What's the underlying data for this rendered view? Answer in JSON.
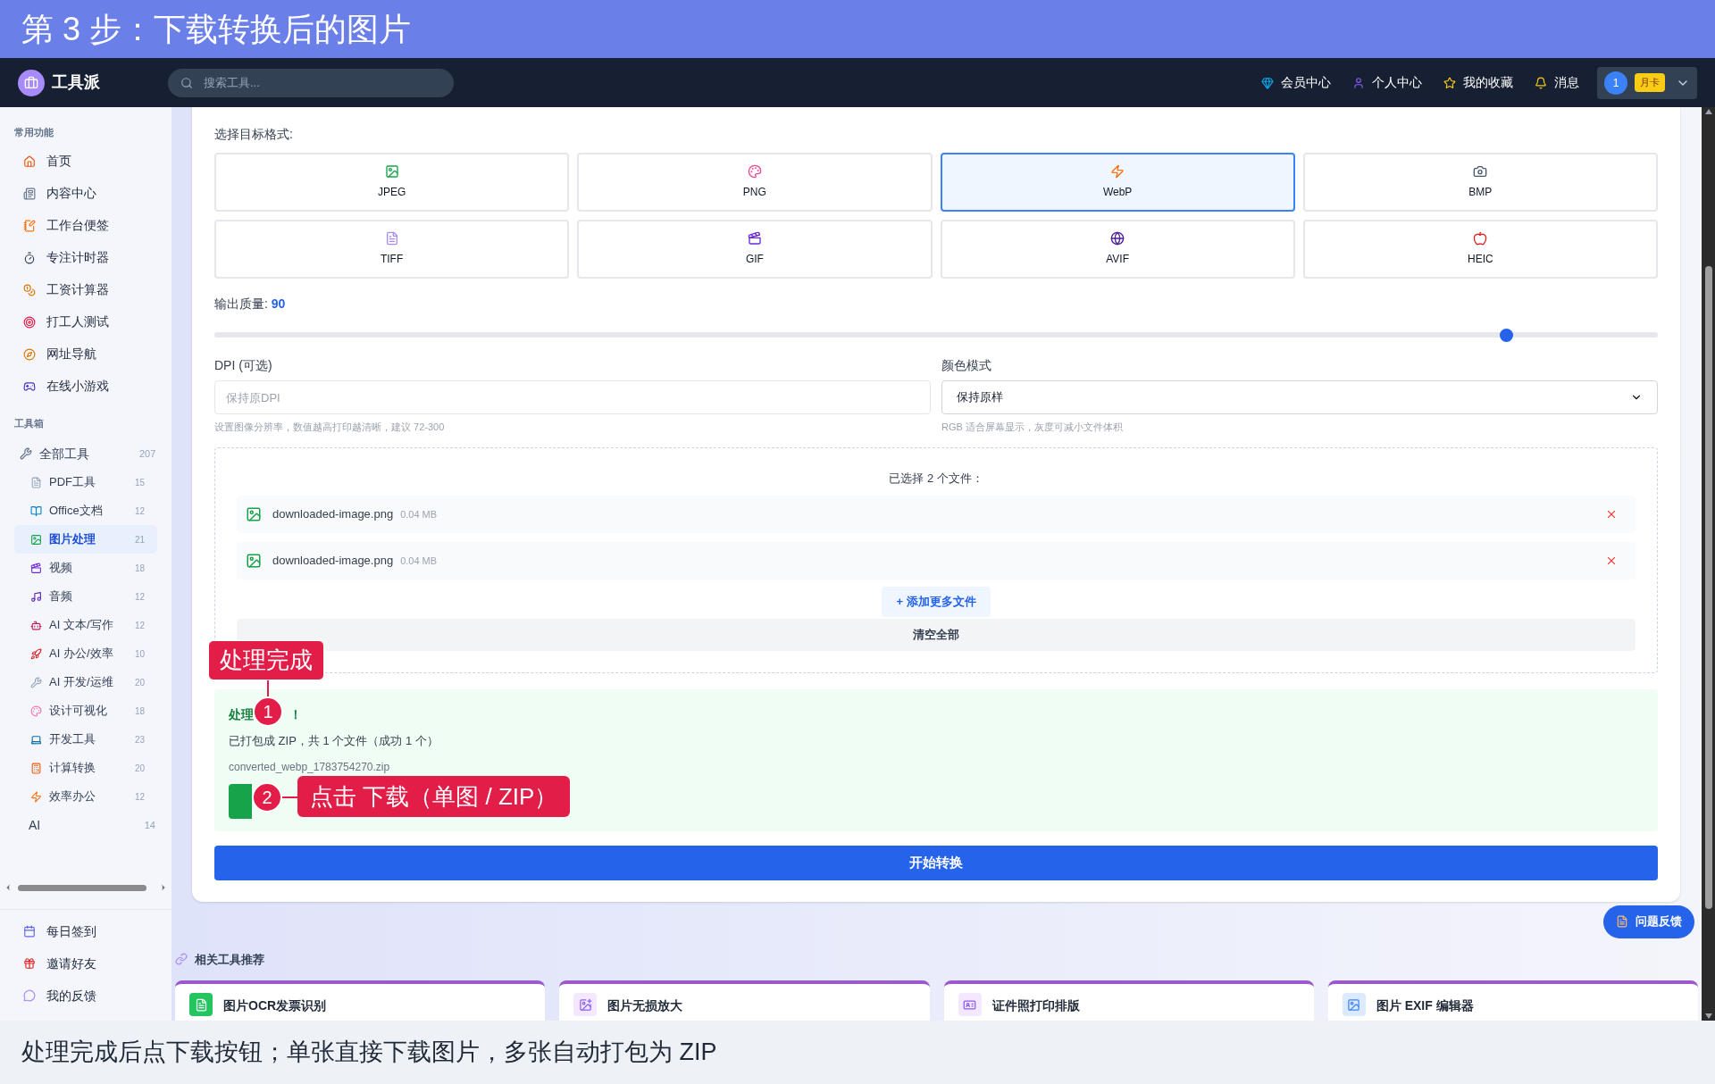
{
  "banner": {
    "title": "第 3 步：下载转换后的图片"
  },
  "header": {
    "logo": "工具派",
    "search_placeholder": "搜索工具...",
    "nav": [
      "会员中心",
      "个人中心",
      "我的收藏",
      "消息"
    ],
    "avatar": "1",
    "badge": "月卡"
  },
  "sidebar": {
    "sections": [
      {
        "title": "常用功能",
        "items": [
          {
            "label": "首页"
          },
          {
            "label": "内容中心"
          },
          {
            "label": "工作台便签"
          },
          {
            "label": "专注计时器"
          },
          {
            "label": "工资计算器"
          },
          {
            "label": "打工人测试"
          },
          {
            "label": "网址导航"
          },
          {
            "label": "在线小游戏"
          }
        ]
      },
      {
        "title": "工具箱",
        "items": [
          {
            "label": "全部工具",
            "count": "207",
            "selected": false,
            "children": [
              {
                "label": "PDF工具",
                "count": "15",
                "selected": false
              },
              {
                "label": "Office文档",
                "count": "12",
                "selected": false
              },
              {
                "label": "图片处理",
                "count": "21",
                "selected": true
              },
              {
                "label": "视频",
                "count": "18",
                "selected": false
              },
              {
                "label": "音频",
                "count": "12",
                "selected": false
              },
              {
                "label": "AI 文本/写作",
                "count": "12",
                "selected": false
              },
              {
                "label": "AI 办公/效率",
                "count": "10",
                "selected": false
              },
              {
                "label": "AI 开发/运维",
                "count": "20",
                "selected": false
              },
              {
                "label": "设计可视化",
                "count": "18",
                "selected": false
              },
              {
                "label": "开发工具",
                "count": "23",
                "selected": false
              },
              {
                "label": "计算转换",
                "count": "20",
                "selected": false
              },
              {
                "label": "效率办公",
                "count": "12",
                "selected": false
              }
            ]
          },
          {
            "label": "AI",
            "count": "14",
            "selected": false
          }
        ]
      }
    ],
    "bottom_items": [
      "每日签到",
      "邀请好友",
      "我的反馈"
    ]
  },
  "format_label": "选择目标格式:",
  "formats": [
    {
      "label": "JPEG",
      "selected": false
    },
    {
      "label": "PNG",
      "selected": false
    },
    {
      "label": "WebP",
      "selected": true
    },
    {
      "label": "BMP",
      "selected": false
    },
    {
      "label": "TIFF",
      "selected": false
    },
    {
      "label": "GIF",
      "selected": false
    },
    {
      "label": "AVIF",
      "selected": false
    },
    {
      "label": "HEIC",
      "selected": false
    }
  ],
  "quality": {
    "label": "输出质量:",
    "value": "90",
    "level": 0.895
  },
  "dpi": {
    "label": "DPI (可选)",
    "placeholder": "保持原DPI",
    "hint": "设置图像分辨率，数值越高打印越清晰，建议 72-300"
  },
  "color_mode": {
    "label": "颜色模式",
    "value": "保持原样",
    "hint": "RGB 适合屏幕显示，灰度可减小文件体积"
  },
  "files": {
    "title": "已选择 2 个文件：",
    "items": [
      {
        "name": "downloaded-image.png",
        "size": "0.04 MB"
      },
      {
        "name": "downloaded-image.png",
        "size": "0.04 MB"
      }
    ],
    "add": "+ 添加更多文件",
    "clear": "清空全部"
  },
  "result": {
    "heading_parts": [
      "处理",
      "！"
    ],
    "summary": "已打包成 ZIP，共 1 个文件（成功 1 个）",
    "filename": "converted_webp_1783754270.zip"
  },
  "start_button": "开始转换",
  "feedback_button": "问题反馈",
  "related": {
    "title": "相关工具推荐",
    "cards": [
      "图片OCR发票识别",
      "图片无损放大",
      "证件照打印排版",
      "图片 EXIF 编辑器"
    ]
  },
  "callouts": [
    {
      "number": "1",
      "label": "处理完成"
    },
    {
      "number": "2",
      "label": "点击 下载（单图 / ZIP）"
    }
  ],
  "caption": "处理完成后点下载按钮；单张直接下载图片，多张自动打包为 ZIP"
}
